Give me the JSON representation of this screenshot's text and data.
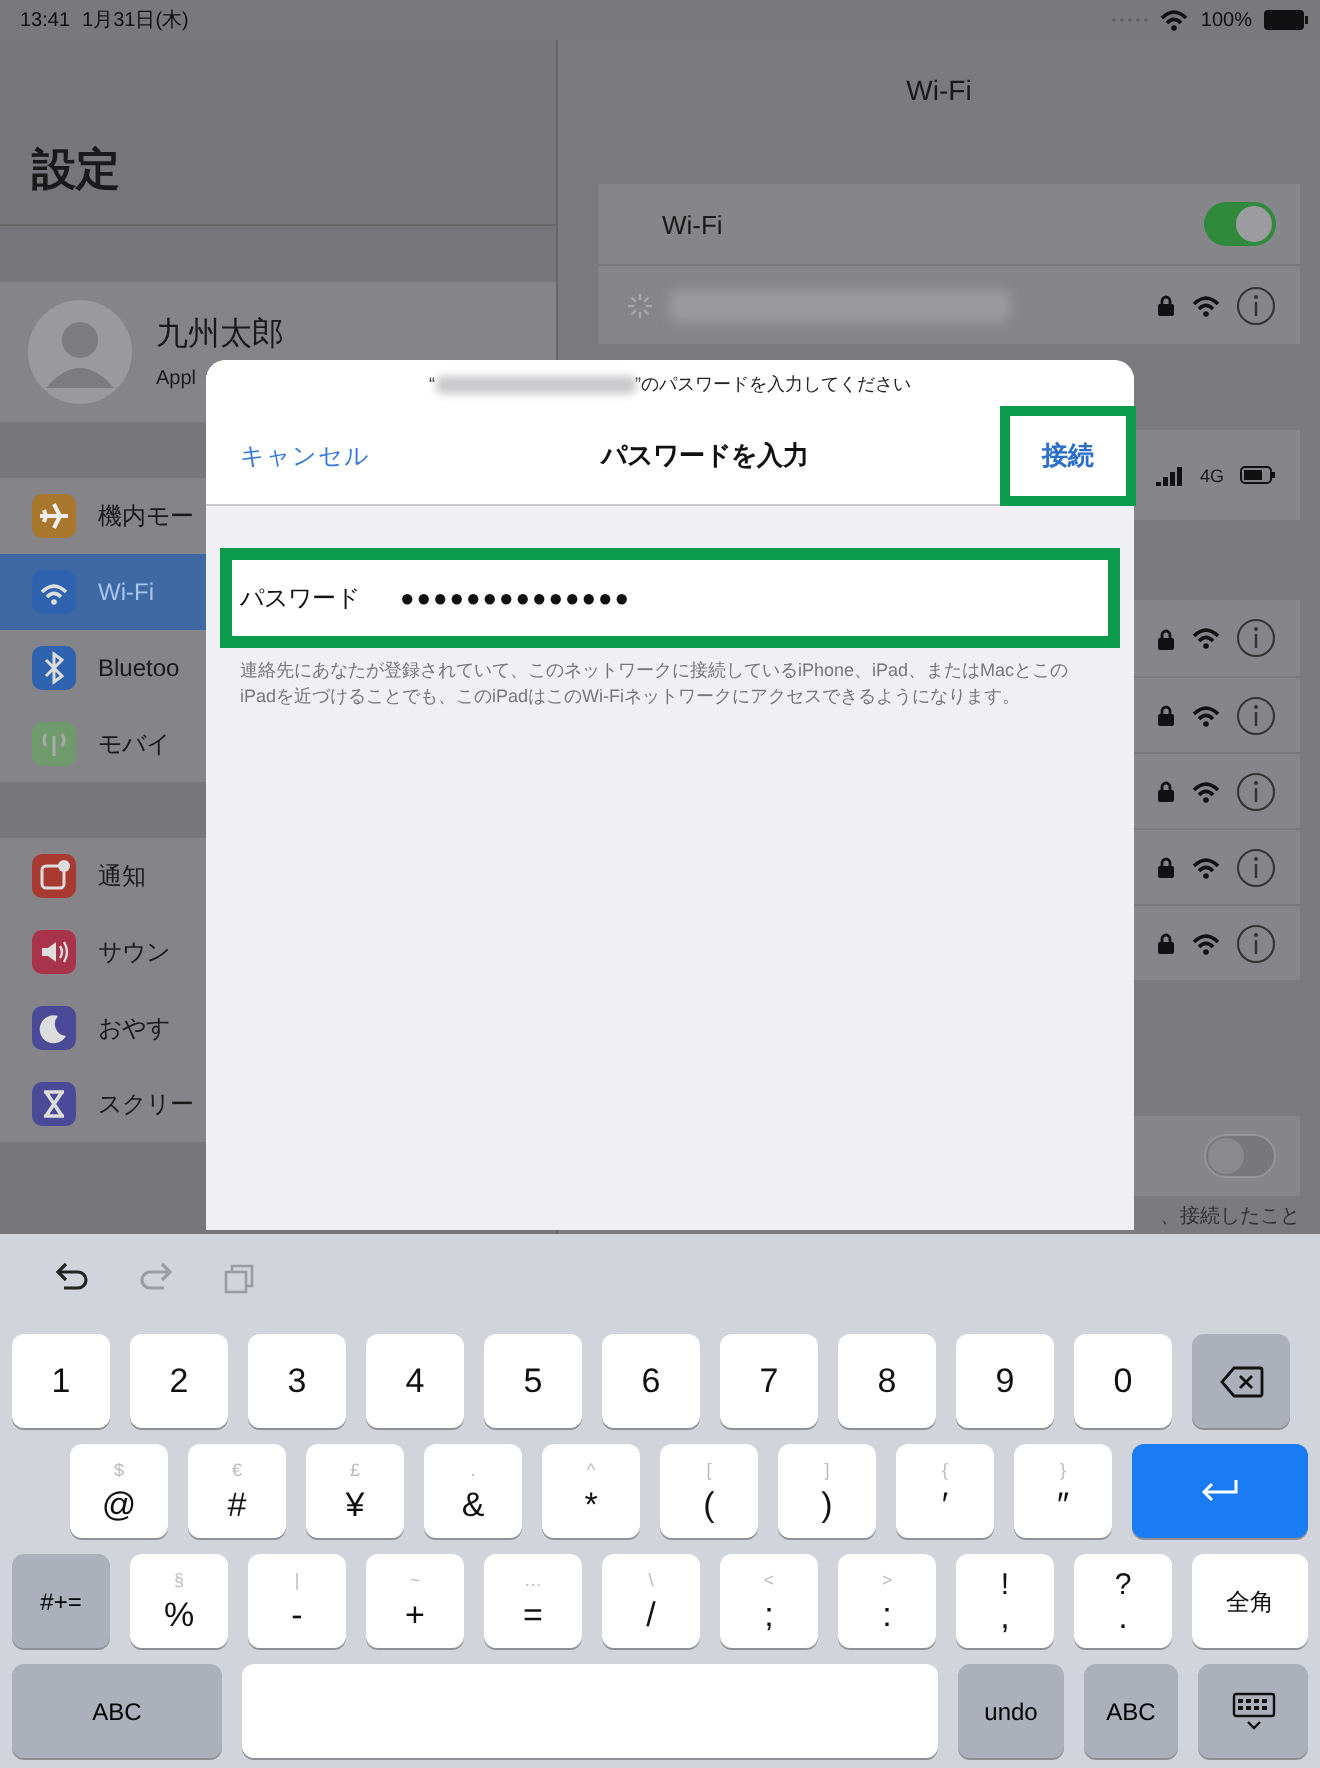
{
  "status_bar": {
    "time": "13:41",
    "date": "1月31日(木)",
    "battery": "100%"
  },
  "settings": {
    "title": "設定",
    "profile": {
      "name": "九州太郎",
      "subtitle": "Appl"
    },
    "groups": [
      [
        {
          "kind": "airplane",
          "label": "機内モー",
          "selected": false
        },
        {
          "kind": "wifi",
          "label": "Wi-Fi",
          "selected": true
        },
        {
          "kind": "bluetooth",
          "label": "Bluetoo",
          "selected": false
        },
        {
          "kind": "cellular",
          "label": "モバイ",
          "selected": false
        }
      ],
      [
        {
          "kind": "notifications",
          "label": "通知",
          "selected": false
        },
        {
          "kind": "sounds",
          "label": "サウン",
          "selected": false
        },
        {
          "kind": "moon",
          "label": "おやす",
          "selected": false
        },
        {
          "kind": "hourglass",
          "label": "スクリー",
          "selected": false
        }
      ]
    ]
  },
  "wifi": {
    "title": "Wi-Fi",
    "toggle": {
      "label": "Wi-Fi",
      "on": true
    },
    "current": {
      "locked": true
    },
    "hotspot": {
      "network": "4G"
    },
    "networks": [
      {
        "locked": true
      },
      {
        "locked": true
      },
      {
        "locked": true
      },
      {
        "locked": true
      },
      {
        "locked": true
      }
    ],
    "ask_toggle": {
      "on": false
    },
    "footer": "、接続したこと"
  },
  "dialog": {
    "prompt_open": "“",
    "prompt_close": "”のパスワードを入力してください",
    "cancel": "キャンセル",
    "title": "パスワードを入力",
    "connect": {
      "label": "接続",
      "highlighted": true
    },
    "field": {
      "label": "パスワード",
      "value": "●●●●●●●●●●●●●●",
      "highlighted": true
    },
    "help": "連絡先にあなたが登録されていて、このネットワークに接続しているiPhone、iPad、またはMacとこのiPadを近づけることでも、このiPadはこのWi-Fiネットワークにアクセスできるようになります。"
  },
  "keyboard": {
    "toolbar": [
      {
        "kind": "undo",
        "disabled": false
      },
      {
        "kind": "redo",
        "disabled": true
      },
      {
        "kind": "paste",
        "disabled": true
      }
    ],
    "rows": [
      {
        "keys": [
          {
            "kind": "char",
            "label": "1"
          },
          {
            "kind": "char",
            "label": "2"
          },
          {
            "kind": "char",
            "label": "3"
          },
          {
            "kind": "char",
            "label": "4"
          },
          {
            "kind": "char",
            "label": "5"
          },
          {
            "kind": "char",
            "label": "6"
          },
          {
            "kind": "char",
            "label": "7"
          },
          {
            "kind": "char",
            "label": "8"
          },
          {
            "kind": "char",
            "label": "9"
          },
          {
            "kind": "char",
            "label": "0"
          },
          {
            "kind": "delete"
          }
        ]
      },
      {
        "keys": [
          {
            "kind": "char",
            "label": "@",
            "hint": "$"
          },
          {
            "kind": "char",
            "label": "#",
            "hint": "€"
          },
          {
            "kind": "char",
            "label": "¥",
            "hint": "£"
          },
          {
            "kind": "char",
            "label": "&",
            "hint": "."
          },
          {
            "kind": "char",
            "label": "*",
            "hint": "^"
          },
          {
            "kind": "char",
            "label": "(",
            "hint": "["
          },
          {
            "kind": "char",
            "label": ")",
            "hint": "]"
          },
          {
            "kind": "char",
            "label": "′",
            "hint": "{"
          },
          {
            "kind": "char",
            "label": "″",
            "hint": "}"
          },
          {
            "kind": "return"
          }
        ]
      },
      {
        "keys": [
          {
            "kind": "mod",
            "label": "#+="
          },
          {
            "kind": "char",
            "label": "%",
            "hint": "§"
          },
          {
            "kind": "char",
            "label": "-",
            "hint": "|"
          },
          {
            "kind": "char",
            "label": "+",
            "hint": "~"
          },
          {
            "kind": "char",
            "label": "=",
            "hint": "…"
          },
          {
            "kind": "char",
            "label": "/",
            "hint": "\\"
          },
          {
            "kind": "char",
            "label": ";",
            "hint": "<"
          },
          {
            "kind": "char",
            "label": ":",
            "hint": ">"
          },
          {
            "kind": "dual",
            "label": ",",
            "hint": "!"
          },
          {
            "kind": "dual",
            "label": ".",
            "hint": "?"
          },
          {
            "kind": "char",
            "label": "全角"
          }
        ]
      },
      {
        "keys": [
          {
            "kind": "mod",
            "label": "ABC"
          },
          {
            "kind": "space"
          },
          {
            "kind": "mod",
            "label": "undo"
          },
          {
            "kind": "mod",
            "label": "ABC"
          },
          {
            "kind": "hide"
          }
        ]
      }
    ]
  }
}
